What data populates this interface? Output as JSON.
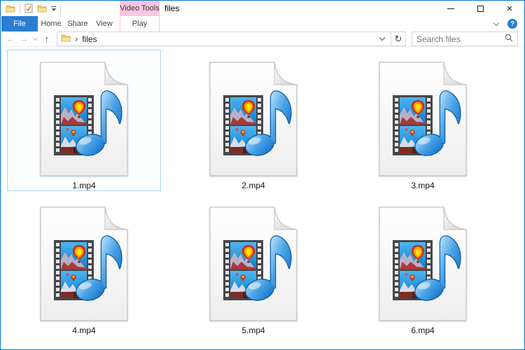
{
  "window": {
    "title": "files",
    "accent_color": "#0078d7"
  },
  "quick_access_toolbar": {
    "icons": [
      "explorer-folder-icon",
      "properties-icon",
      "new-folder-icon",
      "customize-quick-access-icon"
    ]
  },
  "ribbon": {
    "file_tab": {
      "label": "File",
      "color": "#2a7dd2"
    },
    "tabs": [
      "Home",
      "Share",
      "View"
    ],
    "contextual_group": {
      "label": "Video Tools",
      "color": "#fbc6e2",
      "tab": "Play"
    },
    "help_icon": "?",
    "collapse_ribbon_icon": "chevron-down"
  },
  "address_bar": {
    "nav": {
      "back": "←",
      "forward": "→",
      "recent": "chevron-down",
      "up": "↑"
    },
    "breadcrumb": {
      "location_icon": "folder-icon",
      "separator": "›",
      "location": "files"
    },
    "refresh_icon": "↻",
    "search": {
      "placeholder": "Search files",
      "icon": "magnifier"
    }
  },
  "content": {
    "view": "large-icons",
    "file_type": "mp4-video",
    "files": [
      {
        "name": "1.mp4",
        "selected": true
      },
      {
        "name": "2.mp4",
        "selected": false
      },
      {
        "name": "3.mp4",
        "selected": false
      },
      {
        "name": "4.mp4",
        "selected": false
      },
      {
        "name": "5.mp4",
        "selected": false
      },
      {
        "name": "6.mp4",
        "selected": false
      }
    ]
  }
}
